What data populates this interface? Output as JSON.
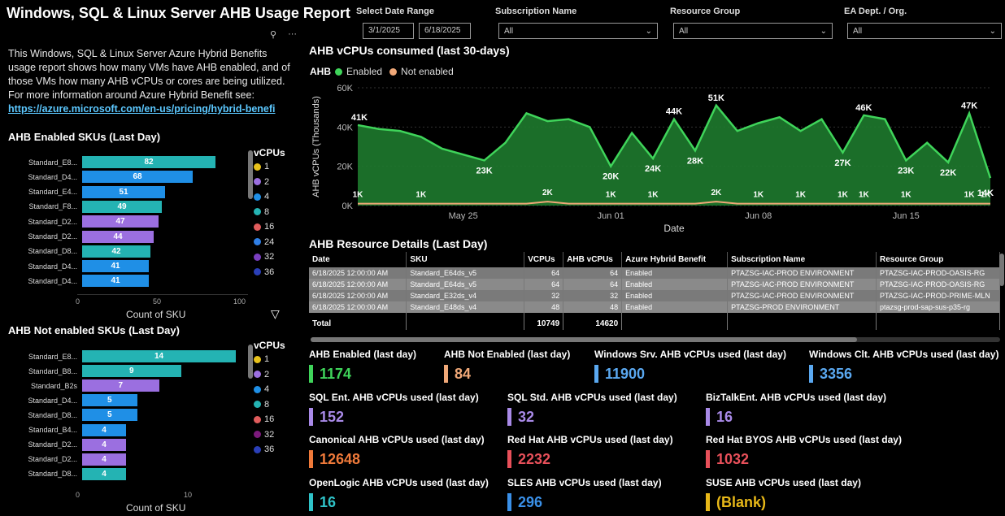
{
  "title": "Windows, SQL & Linux Server AHB Usage Report",
  "description": {
    "text": "This Windows, SQL & Linux Server Azure Hybrid Benefits usage report shows how many VMs have AHB enabled, and of those VMs how many AHB vCPUs or cores are being utilized. For more information around Azure Hybrid Benefit see:",
    "link": "https://azure.microsoft.com/en-us/pricing/hybrid-benefi"
  },
  "filters": {
    "date_range_label": "Select Date Range",
    "start_date": "3/1/2025",
    "end_date": "6/18/2025",
    "subscription_label": "Subscription Name",
    "subscription_value": "All",
    "resource_group_label": "Resource Group",
    "resource_group_value": "All",
    "ea_label": "EA Dept. / Org.",
    "ea_value": "All"
  },
  "enabled_skus": {
    "title": "AHB Enabled SKUs  (Last Day)",
    "xlabel": "Count of SKU",
    "ticks": [
      "0",
      "50",
      "100"
    ],
    "legend_title": "vCPUs",
    "legend": [
      {
        "label": "1",
        "color": "#e8c21a"
      },
      {
        "label": "2",
        "color": "#9b6fe0"
      },
      {
        "label": "4",
        "color": "#1f8fe6"
      },
      {
        "label": "8",
        "color": "#24b3b3"
      },
      {
        "label": "16",
        "color": "#e05c5c"
      },
      {
        "label": "24",
        "color": "#2f7fe6"
      },
      {
        "label": "32",
        "color": "#7b3fc0"
      },
      {
        "label": "36",
        "color": "#2a3fb8"
      }
    ]
  },
  "not_enabled_skus": {
    "title": "AHB Not enabled SKUs (Last Day)",
    "xlabel": "Count of SKU",
    "ticks": [
      "0",
      "10"
    ],
    "legend_title": "vCPUs",
    "legend": [
      {
        "label": "1",
        "color": "#e8c21a"
      },
      {
        "label": "2",
        "color": "#9b6fe0"
      },
      {
        "label": "4",
        "color": "#1f8fe6"
      },
      {
        "label": "8",
        "color": "#24b3b3"
      },
      {
        "label": "16",
        "color": "#e05c5c"
      },
      {
        "label": "32",
        "color": "#7b1a7b"
      },
      {
        "label": "36",
        "color": "#2a3fb8"
      }
    ]
  },
  "area_chart": {
    "title": "AHB vCPUs consumed (last 30-days)",
    "legend_title": "AHB",
    "legend_enabled": "Enabled",
    "legend_not_enabled": "Not enabled",
    "enabled_color": "#3fd45a",
    "not_enabled_color": "#f0a878"
  },
  "details": {
    "title": "AHB Resource Details (Last Day)",
    "columns": [
      "Date",
      "SKU",
      "VCPUs",
      "AHB vCPUs",
      "Azure Hybrid Benefit",
      "Subscription Name",
      "Resource Group"
    ],
    "rows": [
      [
        "6/18/2025 12:00:00 AM",
        "Standard_E64ds_v5",
        "64",
        "64",
        "Enabled",
        "PTAZSG-IAC-PROD ENVIRONMENT",
        "PTAZSG-IAC-PROD-OASIS-RG"
      ],
      [
        "6/18/2025 12:00:00 AM",
        "Standard_E64ds_v5",
        "64",
        "64",
        "Enabled",
        "PTAZSG-IAC-PROD ENVIRONMENT",
        "PTAZSG-IAC-PROD-OASIS-RG"
      ],
      [
        "6/18/2025 12:00:00 AM",
        "Standard_E32ds_v4",
        "32",
        "32",
        "Enabled",
        "PTAZSG-IAC-PROD ENVIRONMENT",
        "PTAZSG-IAC-PROD-PRIME-MLN"
      ],
      [
        "6/18/2025 12:00:00 AM",
        "Standard_E48ds_v4",
        "48",
        "48",
        "Enabled",
        "PTAZSG-PROD ENVIRONMENT",
        "ptazsg-prod-sap-sus-p35-rg"
      ]
    ],
    "total_label": "Total",
    "total_vcpus": "10749",
    "total_ahb": "14620"
  },
  "kpis": {
    "ahb_enabled": {
      "label": "AHB Enabled (last day)",
      "value": "1174",
      "color": "#3fd45a"
    },
    "ahb_not_enabled": {
      "label": "AHB Not Enabled (last day)",
      "value": "84",
      "color": "#f0a878"
    },
    "win_srv": {
      "label": "Windows Srv. AHB vCPUs used (last day)",
      "value": "11900",
      "color": "#5aa8f0"
    },
    "win_clt": {
      "label": "Windows Clt. AHB vCPUs used (last day)",
      "value": "3356",
      "color": "#5aa8f0"
    },
    "sql_ent": {
      "label": "SQL Ent. AHB vCPUs used (last day)",
      "value": "152",
      "color": "#a98ae8"
    },
    "sql_std": {
      "label": "SQL Std. AHB vCPUs used (last day)",
      "value": "32",
      "color": "#a98ae8"
    },
    "biztalk": {
      "label": "BizTalkEnt. AHB vCPUs used (last day)",
      "value": "16",
      "color": "#a98ae8"
    },
    "canonical": {
      "label": "Canonical AHB vCPUs used (last day)",
      "value": "12648",
      "color": "#f07a3a"
    },
    "redhat": {
      "label": "Red Hat AHB vCPUs used (last day)",
      "value": "2232",
      "color": "#e8505a"
    },
    "redhat_byos": {
      "label": "Red Hat BYOS AHB vCPUs used (last day)",
      "value": "1032",
      "color": "#e8505a"
    },
    "openlogic": {
      "label": "OpenLogic AHB vCPUs used (last day)",
      "value": "16",
      "color": "#2fc3c8"
    },
    "sles": {
      "label": "SLES AHB vCPUs used (last day)",
      "value": "296",
      "color": "#3a90e8"
    },
    "suse": {
      "label": "SUSE AHB vCPUs used (last day)",
      "value": "(Blank)",
      "color": "#e8b818"
    }
  },
  "chart_data": [
    {
      "type": "bar",
      "title": "AHB Enabled SKUs  (Last Day)",
      "orientation": "horizontal",
      "categories": [
        "Standard_E8...",
        "Standard_D4...",
        "Standard_E4...",
        "Standard_F8...",
        "Standard_D2...",
        "Standard_D2...",
        "Standard_D8...",
        "Standard_D4...",
        "Standard_D4..."
      ],
      "values": [
        82,
        68,
        51,
        49,
        47,
        44,
        42,
        41,
        41
      ],
      "colors": [
        "#24b3b3",
        "#1f8fe6",
        "#1f8fe6",
        "#24b3b3",
        "#9b6fe0",
        "#9b6fe0",
        "#24b3b3",
        "#1f8fe6",
        "#1f8fe6"
      ],
      "xlabel": "Count of SKU",
      "xlim": [
        0,
        100
      ]
    },
    {
      "type": "bar",
      "title": "AHB Not enabled SKUs (Last Day)",
      "orientation": "horizontal",
      "categories": [
        "Standard_E8...",
        "Standard_B8...",
        "Standard_B2s",
        "Standard_D4...",
        "Standard_D8...",
        "Standard_B4...",
        "Standard_D2...",
        "Standard_D2...",
        "Standard_D8..."
      ],
      "values": [
        14,
        9,
        7,
        5,
        5,
        4,
        4,
        4,
        4
      ],
      "colors": [
        "#24b3b3",
        "#24b3b3",
        "#9b6fe0",
        "#1f8fe6",
        "#1f8fe6",
        "#1f8fe6",
        "#9b6fe0",
        "#9b6fe0",
        "#24b3b3"
      ],
      "xlabel": "Count of SKU",
      "xlim": [
        0,
        15
      ]
    },
    {
      "type": "area",
      "title": "AHB vCPUs consumed (last 30-days)",
      "xlabel": "Date",
      "ylabel": "AHB vCPUs (Thousands)",
      "ylim": [
        0,
        60
      ],
      "y_ticks": [
        "0K",
        "20K",
        "40K",
        "60K"
      ],
      "x_ticks": [
        "May 25",
        "Jun 01",
        "Jun 08",
        "Jun 15"
      ],
      "x": [
        "May 20",
        "May 21",
        "May 22",
        "May 23",
        "May 24",
        "May 25",
        "May 26",
        "May 27",
        "May 28",
        "May 29",
        "May 30",
        "May 31",
        "Jun 01",
        "Jun 02",
        "Jun 03",
        "Jun 04",
        "Jun 05",
        "Jun 06",
        "Jun 07",
        "Jun 08",
        "Jun 09",
        "Jun 10",
        "Jun 11",
        "Jun 12",
        "Jun 13",
        "Jun 14",
        "Jun 15",
        "Jun 16",
        "Jun 17",
        "Jun 18"
      ],
      "series": [
        {
          "name": "Enabled",
          "values": [
            41,
            39,
            38,
            35,
            29,
            26,
            23,
            32,
            47,
            43,
            44,
            40,
            20,
            37,
            24,
            44,
            28,
            51,
            38,
            42,
            45,
            38,
            44,
            27,
            46,
            44,
            23,
            32,
            22,
            47,
            14
          ],
          "labels": {
            "0": "41K",
            "6": "23K",
            "12": "20K",
            "14": "24K",
            "15": "44K",
            "16": "28K",
            "17": "51K",
            "23": "27K",
            "24": "46K",
            "26": "23K",
            "28": "22K",
            "29": "47K",
            "30": "14K"
          }
        },
        {
          "name": "Not enabled",
          "values": [
            1,
            1,
            1,
            1,
            1,
            1,
            1,
            1,
            1,
            2,
            1,
            1,
            1,
            1,
            1,
            1,
            1,
            2,
            1,
            1,
            1,
            1,
            1,
            1,
            1,
            1,
            1,
            1,
            1,
            1,
            1
          ],
          "labels": {
            "0": "1K",
            "3": "1K",
            "9": "2K",
            "12": "1K",
            "14": "1K",
            "17": "2K",
            "19": "1K",
            "21": "1K",
            "23": "1K",
            "24": "1K",
            "26": "1K",
            "29": "1K",
            "30": "1K"
          }
        }
      ]
    }
  ]
}
